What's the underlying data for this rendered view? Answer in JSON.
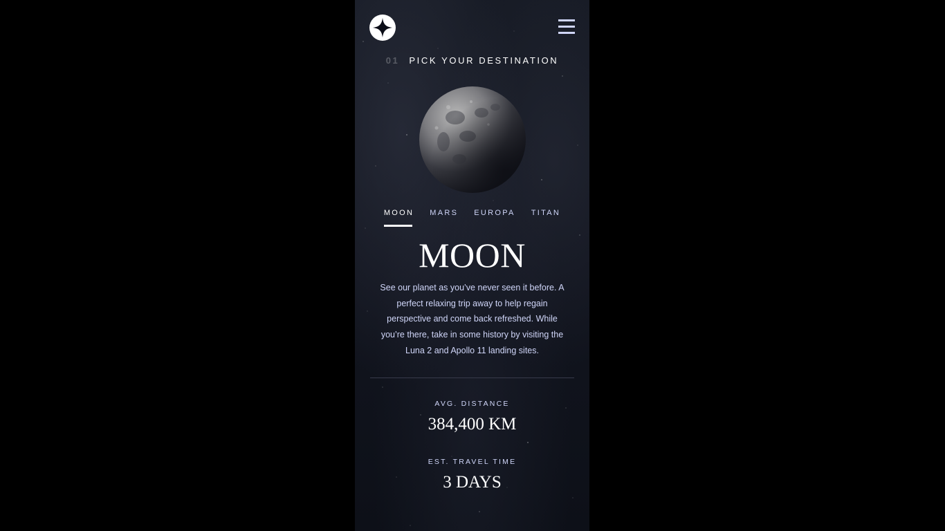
{
  "header": {
    "logo_icon": "star-logo-icon",
    "menu_icon": "hamburger-menu-icon"
  },
  "page": {
    "heading_number": "01",
    "heading_text": "PICK YOUR DESTINATION"
  },
  "tabs": [
    {
      "label": "MOON",
      "active": true
    },
    {
      "label": "MARS",
      "active": false
    },
    {
      "label": "EUROPA",
      "active": false
    },
    {
      "label": "TITAN",
      "active": false
    }
  ],
  "destination": {
    "name": "MOON",
    "description": "See our planet as you’ve never seen it before. A perfect relaxing trip away to help regain perspective and come back refreshed. While you’re there, take in some history by visiting the Luna 2 and Apollo 11 landing sites.",
    "image_icon": "moon-planet-image"
  },
  "stats": {
    "distance_label": "AVG. DISTANCE",
    "distance_value": "384,400 KM",
    "travel_label": "EST. TRAVEL TIME",
    "travel_value": "3 DAYS"
  },
  "colors": {
    "background": "#000000",
    "panel": "#12151f",
    "text": "#ffffff",
    "muted": "#d0d6f9",
    "divider": "#383b4b"
  }
}
